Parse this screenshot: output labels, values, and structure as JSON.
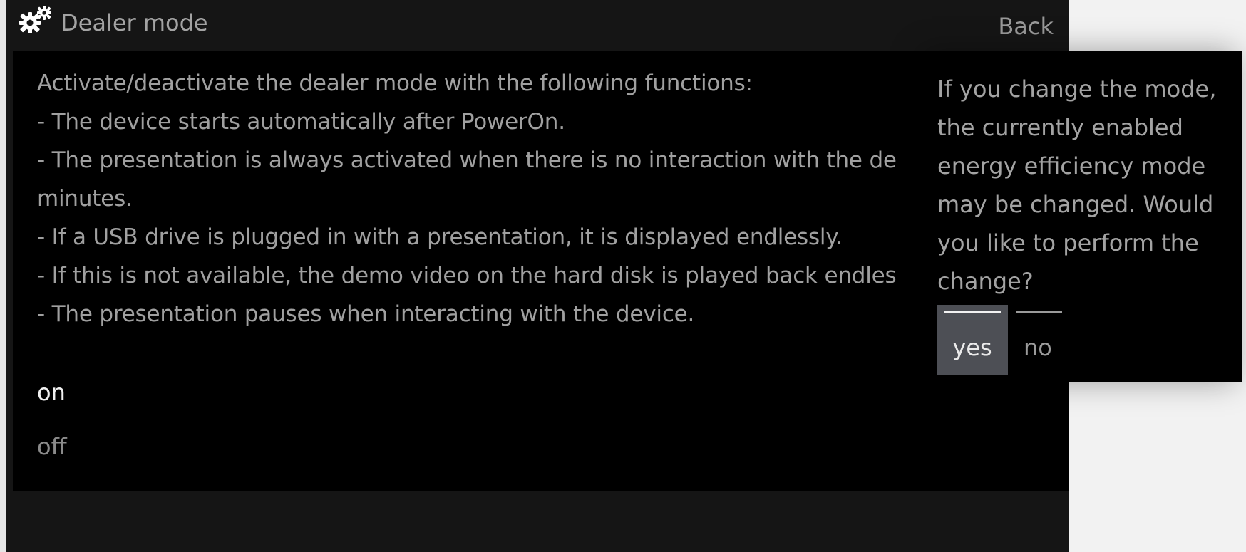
{
  "header": {
    "title": "Dealer mode",
    "back_label": "Back",
    "icon": "gears-icon"
  },
  "description_lines": [
    "Activate/deactivate the dealer mode with the following functions:",
    "- The device starts automatically after PowerOn.",
    "- The presentation is always activated when there is no interaction with the de",
    "minutes.",
    "- If a USB drive is plugged in with a presentation, it is displayed endlessly.",
    "- If this is not available, the demo video on the hard disk is played back endles",
    "- The presentation pauses when interacting with the device."
  ],
  "options": {
    "on_label": "on",
    "off_label": "off",
    "selected": "on"
  },
  "dialog": {
    "message": "If you change the mode, the currently enabled energy efficiency mode may be changed.  Would you like to perform the change?",
    "yes_label": "yes",
    "no_label": "no",
    "focused": "yes"
  },
  "colors": {
    "screen_bg": "#151515",
    "panel_bg": "#000000",
    "text_muted": "#a0a0a0",
    "text_active": "#f0f0f0",
    "focus_bg": "#4d4f55"
  }
}
